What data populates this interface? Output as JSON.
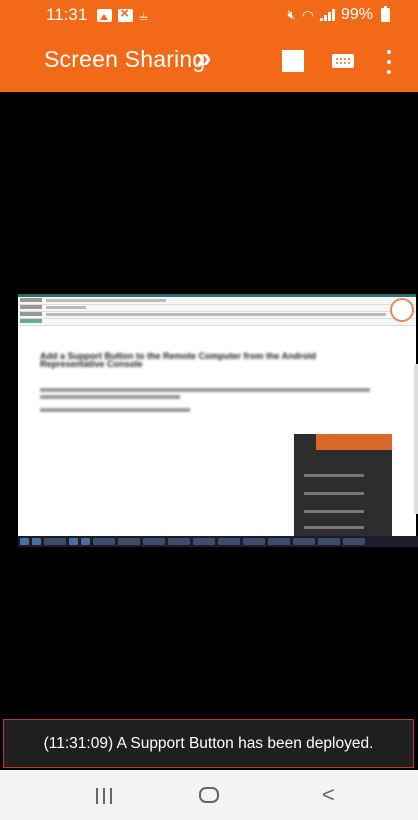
{
  "status_bar": {
    "time": "11:31",
    "battery_percent": "99%",
    "left_icons": [
      "image-icon",
      "close-box-icon",
      "cast-icon"
    ],
    "right_icons": [
      "mute-icon",
      "wifi-icon",
      "signal-icon",
      "battery-icon"
    ]
  },
  "app_bar": {
    "title": "Screen Sharing",
    "title_chevron": "»",
    "actions": [
      "stop-square-icon",
      "keyboard-icon",
      "more-vertical-icon"
    ],
    "background_color": "#f26a17"
  },
  "remote_screen": {
    "heading_text": "Add a Support Button to the Remote Computer from the Android Representative Console"
  },
  "toast": {
    "message": "(11:31:09) A Support Button has been deployed."
  },
  "nav_bar": {
    "recents": "|||",
    "home": "○",
    "back": "<"
  }
}
